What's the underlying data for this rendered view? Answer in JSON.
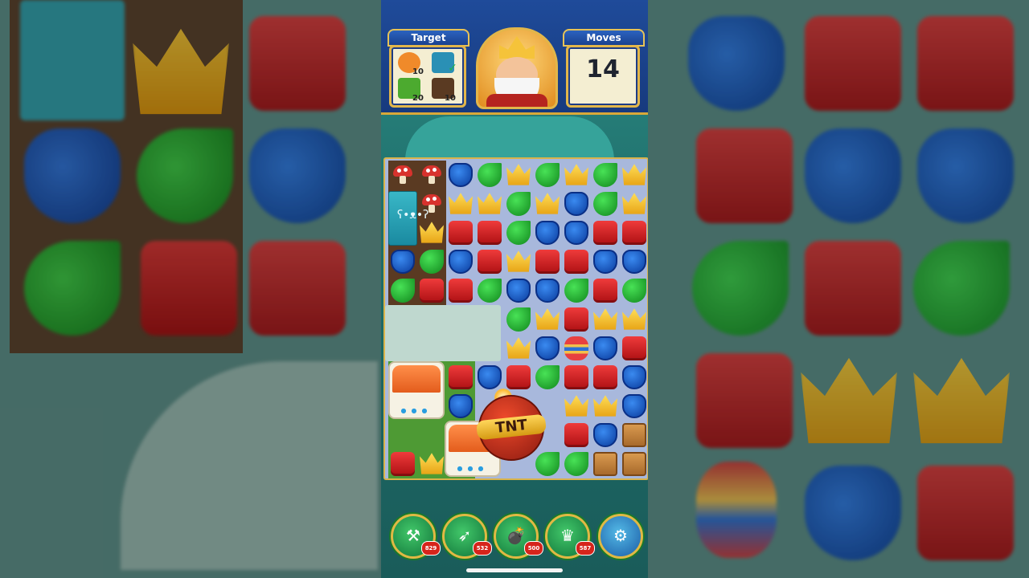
{
  "hud": {
    "target_title": "Target",
    "moves_title": "Moves",
    "moves_value": "14",
    "targets": [
      {
        "icon": "teddy-bear-icon",
        "count": "10"
      },
      {
        "icon": "book-check-icon",
        "count": ""
      },
      {
        "icon": "grass-tile-icon",
        "count": "20"
      },
      {
        "icon": "dirt-tile-icon",
        "count": "10"
      }
    ]
  },
  "board": {
    "tnt_label": "TNT"
  },
  "boosters": [
    {
      "name": "hammer-booster",
      "count": "829"
    },
    {
      "name": "arrow-booster",
      "count": "532"
    },
    {
      "name": "cannon-booster",
      "count": "500"
    },
    {
      "name": "jester-hat-booster",
      "count": "587"
    }
  ],
  "settings_icon": "gear-icon",
  "colors": {
    "hud_blue": "#1f4b9a",
    "gold_border": "#e2b64a",
    "red_gem": "#d82626",
    "blue_gem": "#1c5fd0",
    "green_gem": "#2fb63a",
    "gold_gem": "#f5c12a"
  }
}
